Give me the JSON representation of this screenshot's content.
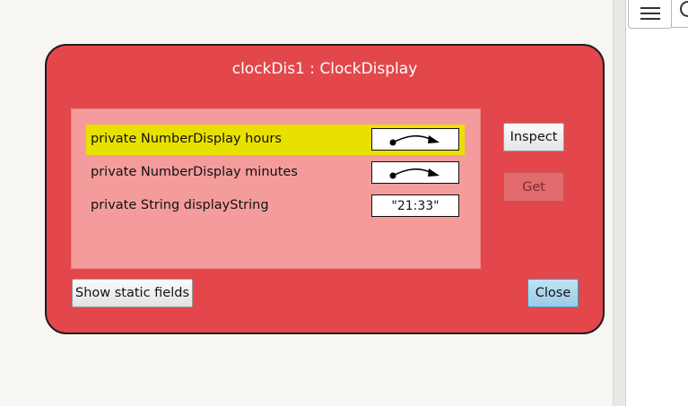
{
  "dialog": {
    "title": "clockDis1 : ClockDisplay",
    "fields": [
      {
        "label": "private NumberDisplay hours",
        "type": "reference",
        "selected": true
      },
      {
        "label": "private NumberDisplay minutes",
        "type": "reference",
        "selected": false
      },
      {
        "label": "private String displayString",
        "type": "value",
        "value": "\"21:33\"",
        "selected": false
      }
    ],
    "buttons": {
      "inspect": "Inspect",
      "get": "Get",
      "show_static": "Show static fields",
      "close": "Close"
    }
  },
  "toolbar": {
    "menu_icon": "hamburger-menu-icon",
    "search_icon": "search-icon"
  },
  "colors": {
    "dialog_bg": "#e3474b",
    "panel_bg": "#f49c9c",
    "selection": "#e8e100",
    "close_button": "#a9d4ec"
  }
}
